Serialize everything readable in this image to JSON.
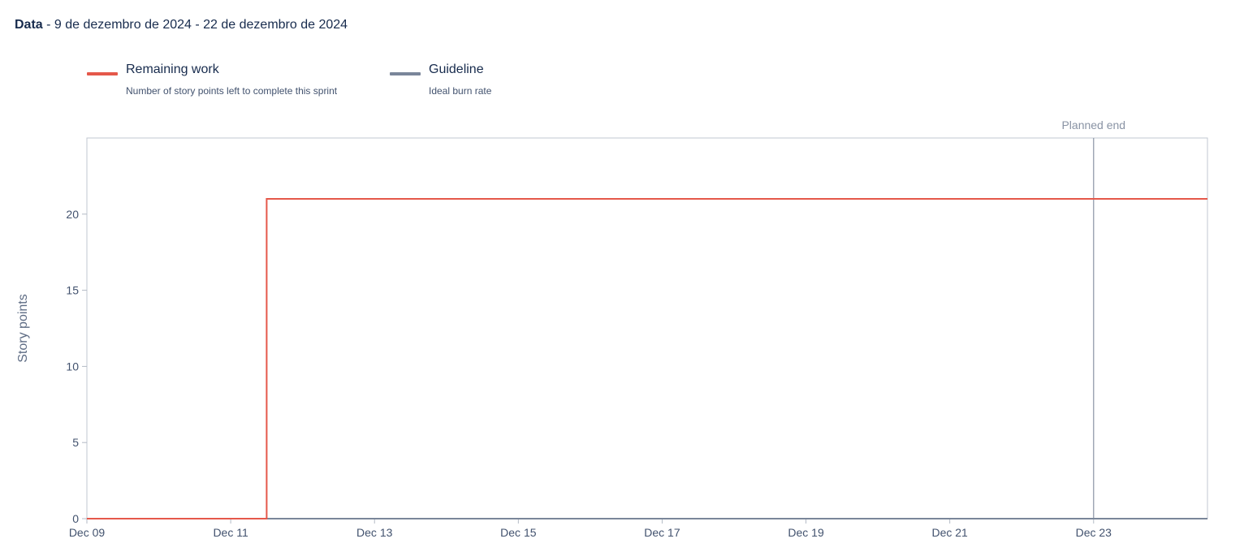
{
  "header": {
    "label": "Data",
    "range": " - 9 de dezembro de 2024 - 22 de dezembro de 2024"
  },
  "legend": [
    {
      "title": "Remaining work",
      "description": "Number of story points left to complete this sprint",
      "color": "#e5584a"
    },
    {
      "title": "Guideline",
      "description": "Ideal burn rate",
      "color": "#7a869a"
    }
  ],
  "chart_data": {
    "type": "line",
    "ylabel": "Story points",
    "xlabel": "",
    "x_ticks": [
      "Dec 09",
      "Dec 11",
      "Dec 13",
      "Dec 15",
      "Dec 17",
      "Dec 19",
      "Dec 21",
      "Dec 23"
    ],
    "x_tick_dates": [
      "2024-12-09",
      "2024-12-11",
      "2024-12-13",
      "2024-12-15",
      "2024-12-17",
      "2024-12-19",
      "2024-12-21",
      "2024-12-23"
    ],
    "xlim": [
      "2024-12-09",
      "2024-12-24 14:00"
    ],
    "y_ticks": [
      0,
      5,
      10,
      15,
      20
    ],
    "ylim": [
      0,
      25
    ],
    "series": [
      {
        "name": "Remaining work",
        "color": "#e5584a",
        "step": true,
        "points": [
          {
            "x": "2024-12-09",
            "y": 0
          },
          {
            "x": "2024-12-11 12:00",
            "y": 0
          },
          {
            "x": "2024-12-11 12:00",
            "y": 21
          },
          {
            "x": "2024-12-24 14:00",
            "y": 21
          }
        ]
      },
      {
        "name": "Guideline",
        "color": "#7a869a",
        "points": [
          {
            "x": "2024-12-09",
            "y": 0
          },
          {
            "x": "2024-12-24 14:00",
            "y": 0
          }
        ]
      }
    ],
    "annotations": [
      {
        "type": "vertical-line",
        "x": "2024-12-23",
        "label": "Planned end",
        "color": "#8993a4"
      }
    ]
  }
}
